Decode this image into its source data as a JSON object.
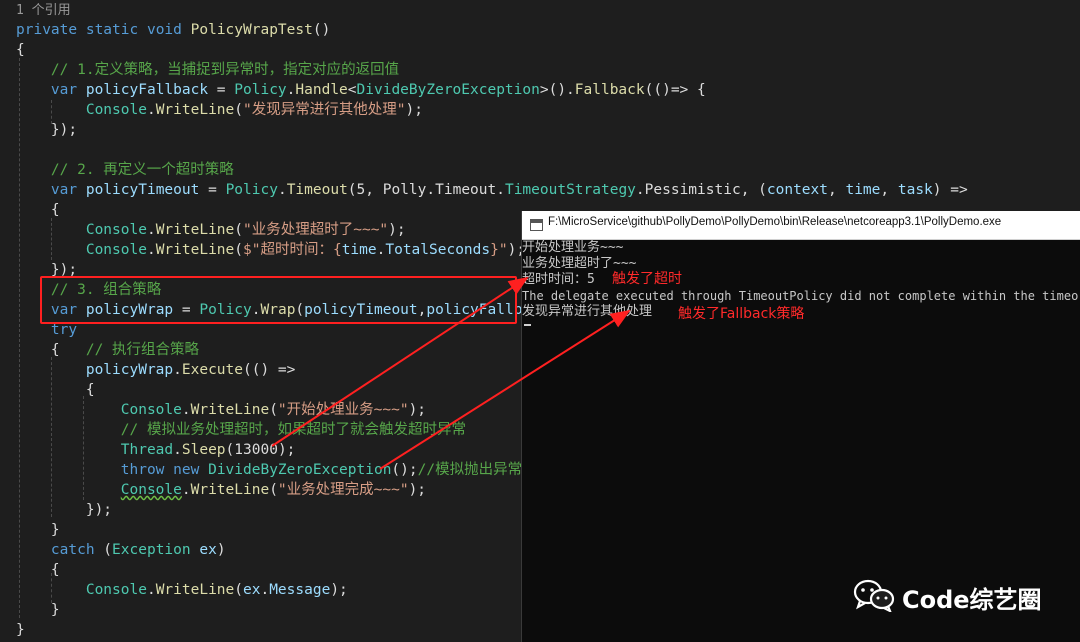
{
  "editor": {
    "ref_count": "1 个引用",
    "lines": {
      "sig_private": "private",
      "sig_static": "static",
      "sig_void": "void",
      "sig_name": "PolicyWrapTest",
      "sig_paren": "()",
      "open_brace": "{",
      "c1": "// 1.定义策略，当捕捉到异常时，指定对应的返回值",
      "l1_var": "var",
      "l1_name": "policyFallback",
      "l1_eq": " = ",
      "l1_policy": "Policy",
      "l1_handle": "Handle",
      "l1_exc": "DivideByZeroException",
      "l1_fallback": "Fallback",
      "l1_rest": "(()=> {",
      "l2_console": "Console",
      "l2_method": "WriteLine",
      "l2_str": "\"发现异常进行其他处理\"",
      "l3": "});",
      "c2": "// 2. 再定义一个超时策略",
      "l4_var": "var",
      "l4_name": "policyTimeout",
      "l4_policy": "Policy",
      "l4_timeout": "Timeout",
      "l4_arg5": "5",
      "l4_polly": "Polly",
      "l4_timeout2": "Timeout",
      "l4_strategy": "TimeoutStrategy",
      "l4_pess": "Pessimistic",
      "l4_context": "context",
      "l4_time": "time",
      "l4_task": "task",
      "l5": "{",
      "l6_console": "Console",
      "l6_method": "WriteLine",
      "l6_str": "\"业务处理超时了~~~\"",
      "l7_console": "Console",
      "l7_method": "WriteLine",
      "l7_str_a": "$\"超时时间：{",
      "l7_time": "time",
      "l7_total": "TotalSeconds",
      "l7_str_b": "}\"",
      "l8": "});",
      "c3": "// 3. 组合策略",
      "l9_var": "var",
      "l9_name": "policyWrap",
      "l9_policy": "Policy",
      "l9_wrap": "Wrap",
      "l9_a1": "policyTimeout",
      "l9_a2": "policyFallback",
      "l10": "try",
      "l11_brace": "{",
      "c4": "// 执行组合策略",
      "l12_name": "policyWrap",
      "l12_exec": "Execute",
      "l12_rest": "(() =>",
      "l13": "{",
      "l14_console": "Console",
      "l14_method": "WriteLine",
      "l14_str": "\"开始处理业务~~~\"",
      "c5": "// 模拟业务处理超时，如果超时了就会触发超时异常",
      "l15_thread": "Thread",
      "l15_sleep": "Sleep",
      "l15_arg": "13000",
      "l16_throw": "throw",
      "l16_new": "new",
      "l16_exc": "DivideByZeroException",
      "c6": "//模拟抛出异常",
      "l17_console": "Console",
      "l17_method": "WriteLine",
      "l17_str": "\"业务处理完成~~~\"",
      "l18": "});",
      "l19": "}",
      "l20_catch": "catch",
      "l20_exc": "Exception",
      "l20_ex": "ex",
      "l21": "{",
      "l22_console": "Console",
      "l22_method": "WriteLine",
      "l22_ex": "ex",
      "l22_msg": "Message",
      "l23": "}",
      "close_brace": "}"
    }
  },
  "console": {
    "title": "F:\\MicroService\\github\\PollyDemo\\PollyDemo\\bin\\Release\\netcoreapp3.1\\PollyDemo.exe",
    "output": [
      "开始处理业务~~~",
      "业务处理超时了~~~",
      "超时时间：5",
      "The delegate executed through TimeoutPolicy did not complete within the timeo",
      "发现异常进行其他处理"
    ]
  },
  "annotations": {
    "timeout_triggered": "触发了超时",
    "fallback_triggered": "触发了Fallback策略"
  },
  "watermark": {
    "text": "Code综艺圈",
    "icon": "wechat-icon"
  },
  "colors": {
    "editor_bg": "#1e1e1e",
    "keyword": "#569cd6",
    "type": "#4ec9b0",
    "identifier": "#9cdcfe",
    "method": "#dcdcaa",
    "string": "#d69d85",
    "comment": "#57a64a",
    "annotation_red": "#ff2020",
    "console_bg": "#0c0c0c"
  }
}
